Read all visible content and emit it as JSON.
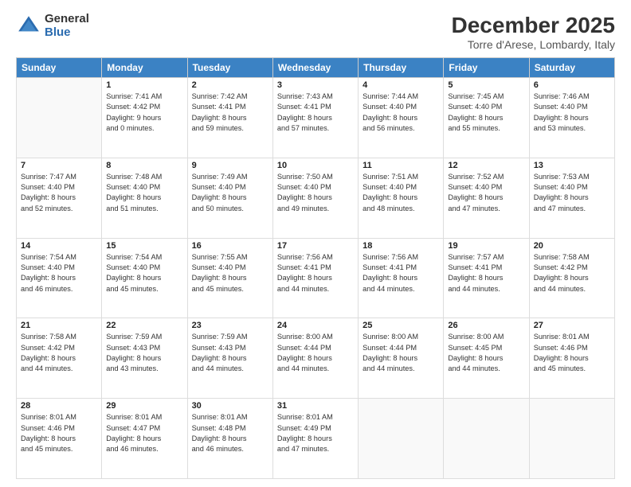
{
  "logo": {
    "general": "General",
    "blue": "Blue"
  },
  "header": {
    "month": "December 2025",
    "location": "Torre d'Arese, Lombardy, Italy"
  },
  "days_of_week": [
    "Sunday",
    "Monday",
    "Tuesday",
    "Wednesday",
    "Thursday",
    "Friday",
    "Saturday"
  ],
  "weeks": [
    [
      {
        "day": "",
        "content": ""
      },
      {
        "day": "1",
        "content": "Sunrise: 7:41 AM\nSunset: 4:42 PM\nDaylight: 9 hours\nand 0 minutes."
      },
      {
        "day": "2",
        "content": "Sunrise: 7:42 AM\nSunset: 4:41 PM\nDaylight: 8 hours\nand 59 minutes."
      },
      {
        "day": "3",
        "content": "Sunrise: 7:43 AM\nSunset: 4:41 PM\nDaylight: 8 hours\nand 57 minutes."
      },
      {
        "day": "4",
        "content": "Sunrise: 7:44 AM\nSunset: 4:40 PM\nDaylight: 8 hours\nand 56 minutes."
      },
      {
        "day": "5",
        "content": "Sunrise: 7:45 AM\nSunset: 4:40 PM\nDaylight: 8 hours\nand 55 minutes."
      },
      {
        "day": "6",
        "content": "Sunrise: 7:46 AM\nSunset: 4:40 PM\nDaylight: 8 hours\nand 53 minutes."
      }
    ],
    [
      {
        "day": "7",
        "content": "Sunrise: 7:47 AM\nSunset: 4:40 PM\nDaylight: 8 hours\nand 52 minutes."
      },
      {
        "day": "8",
        "content": "Sunrise: 7:48 AM\nSunset: 4:40 PM\nDaylight: 8 hours\nand 51 minutes."
      },
      {
        "day": "9",
        "content": "Sunrise: 7:49 AM\nSunset: 4:40 PM\nDaylight: 8 hours\nand 50 minutes."
      },
      {
        "day": "10",
        "content": "Sunrise: 7:50 AM\nSunset: 4:40 PM\nDaylight: 8 hours\nand 49 minutes."
      },
      {
        "day": "11",
        "content": "Sunrise: 7:51 AM\nSunset: 4:40 PM\nDaylight: 8 hours\nand 48 minutes."
      },
      {
        "day": "12",
        "content": "Sunrise: 7:52 AM\nSunset: 4:40 PM\nDaylight: 8 hours\nand 47 minutes."
      },
      {
        "day": "13",
        "content": "Sunrise: 7:53 AM\nSunset: 4:40 PM\nDaylight: 8 hours\nand 47 minutes."
      }
    ],
    [
      {
        "day": "14",
        "content": "Sunrise: 7:54 AM\nSunset: 4:40 PM\nDaylight: 8 hours\nand 46 minutes."
      },
      {
        "day": "15",
        "content": "Sunrise: 7:54 AM\nSunset: 4:40 PM\nDaylight: 8 hours\nand 45 minutes."
      },
      {
        "day": "16",
        "content": "Sunrise: 7:55 AM\nSunset: 4:40 PM\nDaylight: 8 hours\nand 45 minutes."
      },
      {
        "day": "17",
        "content": "Sunrise: 7:56 AM\nSunset: 4:41 PM\nDaylight: 8 hours\nand 44 minutes."
      },
      {
        "day": "18",
        "content": "Sunrise: 7:56 AM\nSunset: 4:41 PM\nDaylight: 8 hours\nand 44 minutes."
      },
      {
        "day": "19",
        "content": "Sunrise: 7:57 AM\nSunset: 4:41 PM\nDaylight: 8 hours\nand 44 minutes."
      },
      {
        "day": "20",
        "content": "Sunrise: 7:58 AM\nSunset: 4:42 PM\nDaylight: 8 hours\nand 44 minutes."
      }
    ],
    [
      {
        "day": "21",
        "content": "Sunrise: 7:58 AM\nSunset: 4:42 PM\nDaylight: 8 hours\nand 44 minutes."
      },
      {
        "day": "22",
        "content": "Sunrise: 7:59 AM\nSunset: 4:43 PM\nDaylight: 8 hours\nand 43 minutes."
      },
      {
        "day": "23",
        "content": "Sunrise: 7:59 AM\nSunset: 4:43 PM\nDaylight: 8 hours\nand 44 minutes."
      },
      {
        "day": "24",
        "content": "Sunrise: 8:00 AM\nSunset: 4:44 PM\nDaylight: 8 hours\nand 44 minutes."
      },
      {
        "day": "25",
        "content": "Sunrise: 8:00 AM\nSunset: 4:44 PM\nDaylight: 8 hours\nand 44 minutes."
      },
      {
        "day": "26",
        "content": "Sunrise: 8:00 AM\nSunset: 4:45 PM\nDaylight: 8 hours\nand 44 minutes."
      },
      {
        "day": "27",
        "content": "Sunrise: 8:01 AM\nSunset: 4:46 PM\nDaylight: 8 hours\nand 45 minutes."
      }
    ],
    [
      {
        "day": "28",
        "content": "Sunrise: 8:01 AM\nSunset: 4:46 PM\nDaylight: 8 hours\nand 45 minutes."
      },
      {
        "day": "29",
        "content": "Sunrise: 8:01 AM\nSunset: 4:47 PM\nDaylight: 8 hours\nand 46 minutes."
      },
      {
        "day": "30",
        "content": "Sunrise: 8:01 AM\nSunset: 4:48 PM\nDaylight: 8 hours\nand 46 minutes."
      },
      {
        "day": "31",
        "content": "Sunrise: 8:01 AM\nSunset: 4:49 PM\nDaylight: 8 hours\nand 47 minutes."
      },
      {
        "day": "",
        "content": ""
      },
      {
        "day": "",
        "content": ""
      },
      {
        "day": "",
        "content": ""
      }
    ]
  ]
}
